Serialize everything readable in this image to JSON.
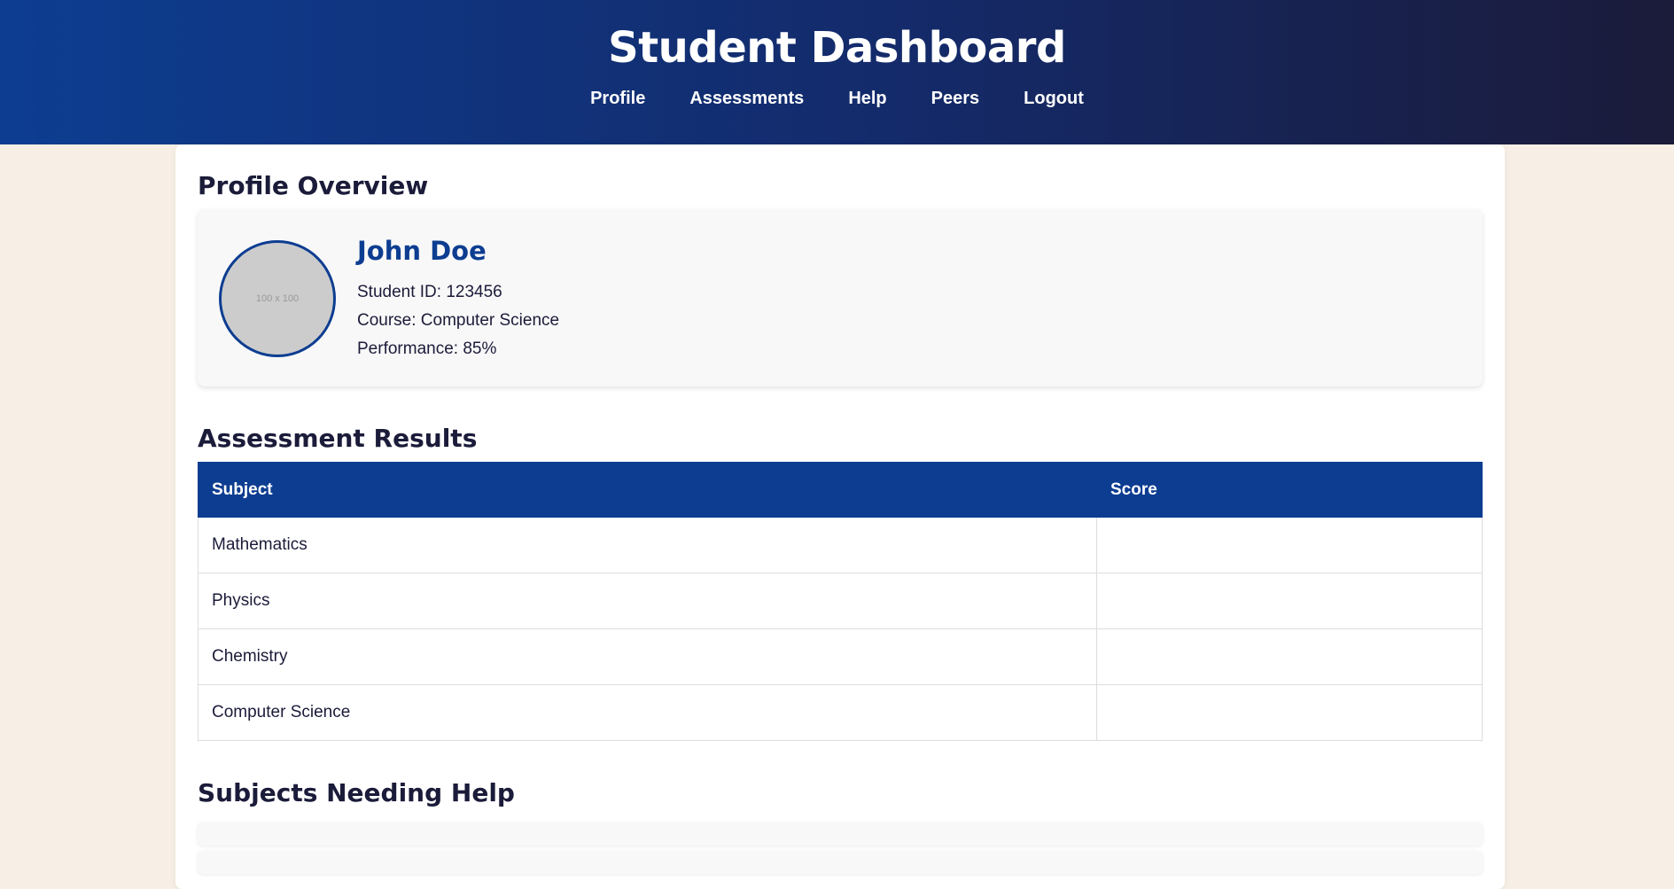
{
  "header": {
    "title": "Student Dashboard",
    "nav": [
      "Profile",
      "Assessments",
      "Help",
      "Peers",
      "Logout"
    ]
  },
  "profile": {
    "section_title": "Profile Overview",
    "avatar_placeholder": "100 x 100",
    "name": "John Doe",
    "student_id": "Student ID: 123456",
    "course": "Course: Computer Science",
    "performance": "Performance: 85%"
  },
  "assessments": {
    "section_title": "Assessment Results",
    "columns": [
      "Subject",
      "Score"
    ],
    "rows": [
      [
        "Mathematics",
        ""
      ],
      [
        "Physics",
        ""
      ],
      [
        "Chemistry",
        ""
      ],
      [
        "Computer Science",
        ""
      ]
    ]
  },
  "help": {
    "section_title": "Subjects Needing Help"
  },
  "colors": {
    "primary": "#0d3d91",
    "dark": "#1b1b3a",
    "background": "#f7efe5"
  }
}
